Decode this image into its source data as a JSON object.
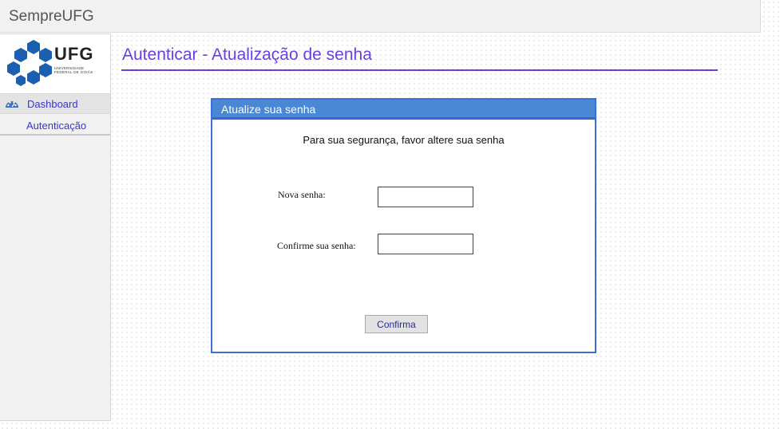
{
  "app": {
    "title": "SempreUFG"
  },
  "sidebar": {
    "logo": {
      "name": "UFG",
      "subtitle_line1": "UNIVERSIDADE",
      "subtitle_line2": "FEDERAL DE GOIÁS"
    },
    "items": [
      {
        "label": "Dashboard",
        "icon": "dashboard-icon"
      },
      {
        "label": "Autenticação"
      }
    ]
  },
  "main": {
    "title": "Autenticar - Atualização de senha"
  },
  "panel": {
    "header": "Atualize sua senha",
    "message": "Para sua segurança, favor altere sua senha",
    "fields": [
      {
        "label": "Nova senha:",
        "value": ""
      },
      {
        "label": "Confirme sua senha:",
        "value": ""
      }
    ],
    "confirm_label": "Confirma"
  },
  "colors": {
    "title": "#6a3fe0",
    "panel_header": "#4a88d4",
    "panel_border": "#3a70d8",
    "nav_link": "#3a37c8",
    "logo_hex": "#1b5fb0"
  }
}
